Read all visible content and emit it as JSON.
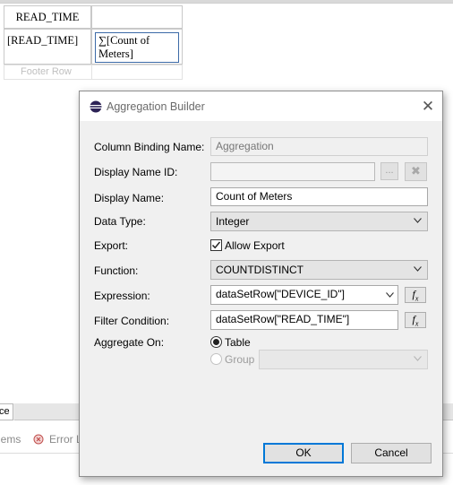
{
  "report_table": {
    "header_col1": "READ_TIME",
    "detail_col1": "[READ_TIME]",
    "detail_col2_symbol": "∑",
    "detail_col2_text": "[Count of Meters]",
    "footer_label": "Footer Row"
  },
  "bottom_panel": {
    "tab_label": "ce",
    "items": [
      "lems",
      "Error L"
    ]
  },
  "dialog": {
    "title": "Aggregation Builder",
    "close_label": "✕",
    "fields": {
      "column_binding_name": {
        "label": "Column Binding Name:",
        "value": "Aggregation"
      },
      "display_name_id": {
        "label": "Display Name ID:",
        "value": "",
        "browse_label": "...",
        "clear_label": "✖"
      },
      "display_name": {
        "label": "Display Name:",
        "value": "Count of Meters"
      },
      "data_type": {
        "label": "Data Type:",
        "value": "Integer"
      },
      "export": {
        "label": "Export:",
        "checkbox_label": "Allow Export",
        "checked": true
      },
      "function": {
        "label": "Function:",
        "value": "COUNTDISTINCT"
      },
      "expression": {
        "label": "Expression:",
        "value": "dataSetRow[\"DEVICE_ID\"]"
      },
      "filter_condition": {
        "label": "Filter Condition:",
        "value": "dataSetRow[\"READ_TIME\"]"
      },
      "aggregate_on": {
        "label": "Aggregate On:",
        "option_table": "Table",
        "option_group": "Group",
        "selected": "Table",
        "group_value": ""
      }
    },
    "buttons": {
      "ok": "OK",
      "cancel": "Cancel"
    },
    "colors": {
      "default_button_border": "#0078d7",
      "dialog_bg": "#f0f0f0"
    }
  }
}
